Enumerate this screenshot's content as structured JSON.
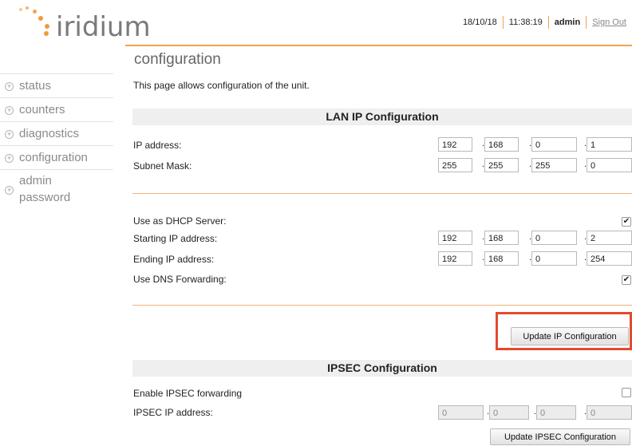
{
  "app": {
    "logo_text": "iridium"
  },
  "topbar": {
    "date": "18/10/18",
    "time": "11:38:19",
    "user": "admin",
    "signout": "Sign Out"
  },
  "sidebar": {
    "items": [
      {
        "label": "status"
      },
      {
        "label": "counters"
      },
      {
        "label": "diagnostics"
      },
      {
        "label": "configuration"
      },
      {
        "label_line1": "admin",
        "label_line2": "password"
      }
    ]
  },
  "page": {
    "title": "configuration",
    "description": "This page allows configuration of the unit."
  },
  "lan": {
    "heading": "LAN IP Configuration",
    "ip_label": "IP address:",
    "ip": [
      "192",
      "168",
      "0",
      "1"
    ],
    "mask_label": "Subnet Mask:",
    "mask": [
      "255",
      "255",
      "255",
      "0"
    ]
  },
  "dhcp": {
    "server_label": "Use as DHCP Server:",
    "server_checked": true,
    "start_label": "Starting IP address:",
    "start": [
      "192",
      "168",
      "0",
      "2"
    ],
    "end_label": "Ending IP address:",
    "end": [
      "192",
      "168",
      "0",
      "254"
    ],
    "dns_label": "Use DNS Forwarding:",
    "dns_checked": true,
    "update_button": "Update IP Configuration"
  },
  "ipsec": {
    "heading": "IPSEC Configuration",
    "enable_label": "Enable IPSEC forwarding",
    "enable_checked": false,
    "ip_label": "IPSEC IP address:",
    "ip": [
      "0",
      "0",
      "0",
      "0"
    ],
    "update_button": "Update IPSEC Configuration"
  },
  "colors": {
    "accent": "#f5a24b",
    "highlight": "#e24a2f",
    "logo_gray": "#7a7a7a"
  }
}
